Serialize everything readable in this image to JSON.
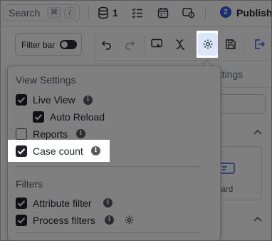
{
  "topbar": {
    "search_label": "Search",
    "shortcut_keys": [
      "⌘",
      "/"
    ],
    "db_count": "1",
    "notification_count": "2",
    "publish_label": "Publish"
  },
  "toolbar": {
    "filter_bar_label": "Filter bar",
    "filter_bar_enabled": false
  },
  "side_panel": {
    "settings_tab_label": "ettings",
    "card_label": "l card"
  },
  "dropdown": {
    "view_settings_title": "View Settings",
    "live_view_label": "Live View",
    "live_view_checked": true,
    "auto_reload_label": "Auto Reload",
    "auto_reload_checked": true,
    "reports_label": "Reports",
    "reports_checked": false,
    "case_count_label": "Case count",
    "case_count_checked": true,
    "filters_title": "Filters",
    "attribute_filter_label": "Attribute filter",
    "attribute_filter_checked": true,
    "process_filters_label": "Process filters",
    "process_filters_checked": true
  },
  "colors": {
    "accent": "#2f5bea",
    "highlight_bg": "#dbe6fb",
    "checkbox_checked": "#1f2329"
  }
}
